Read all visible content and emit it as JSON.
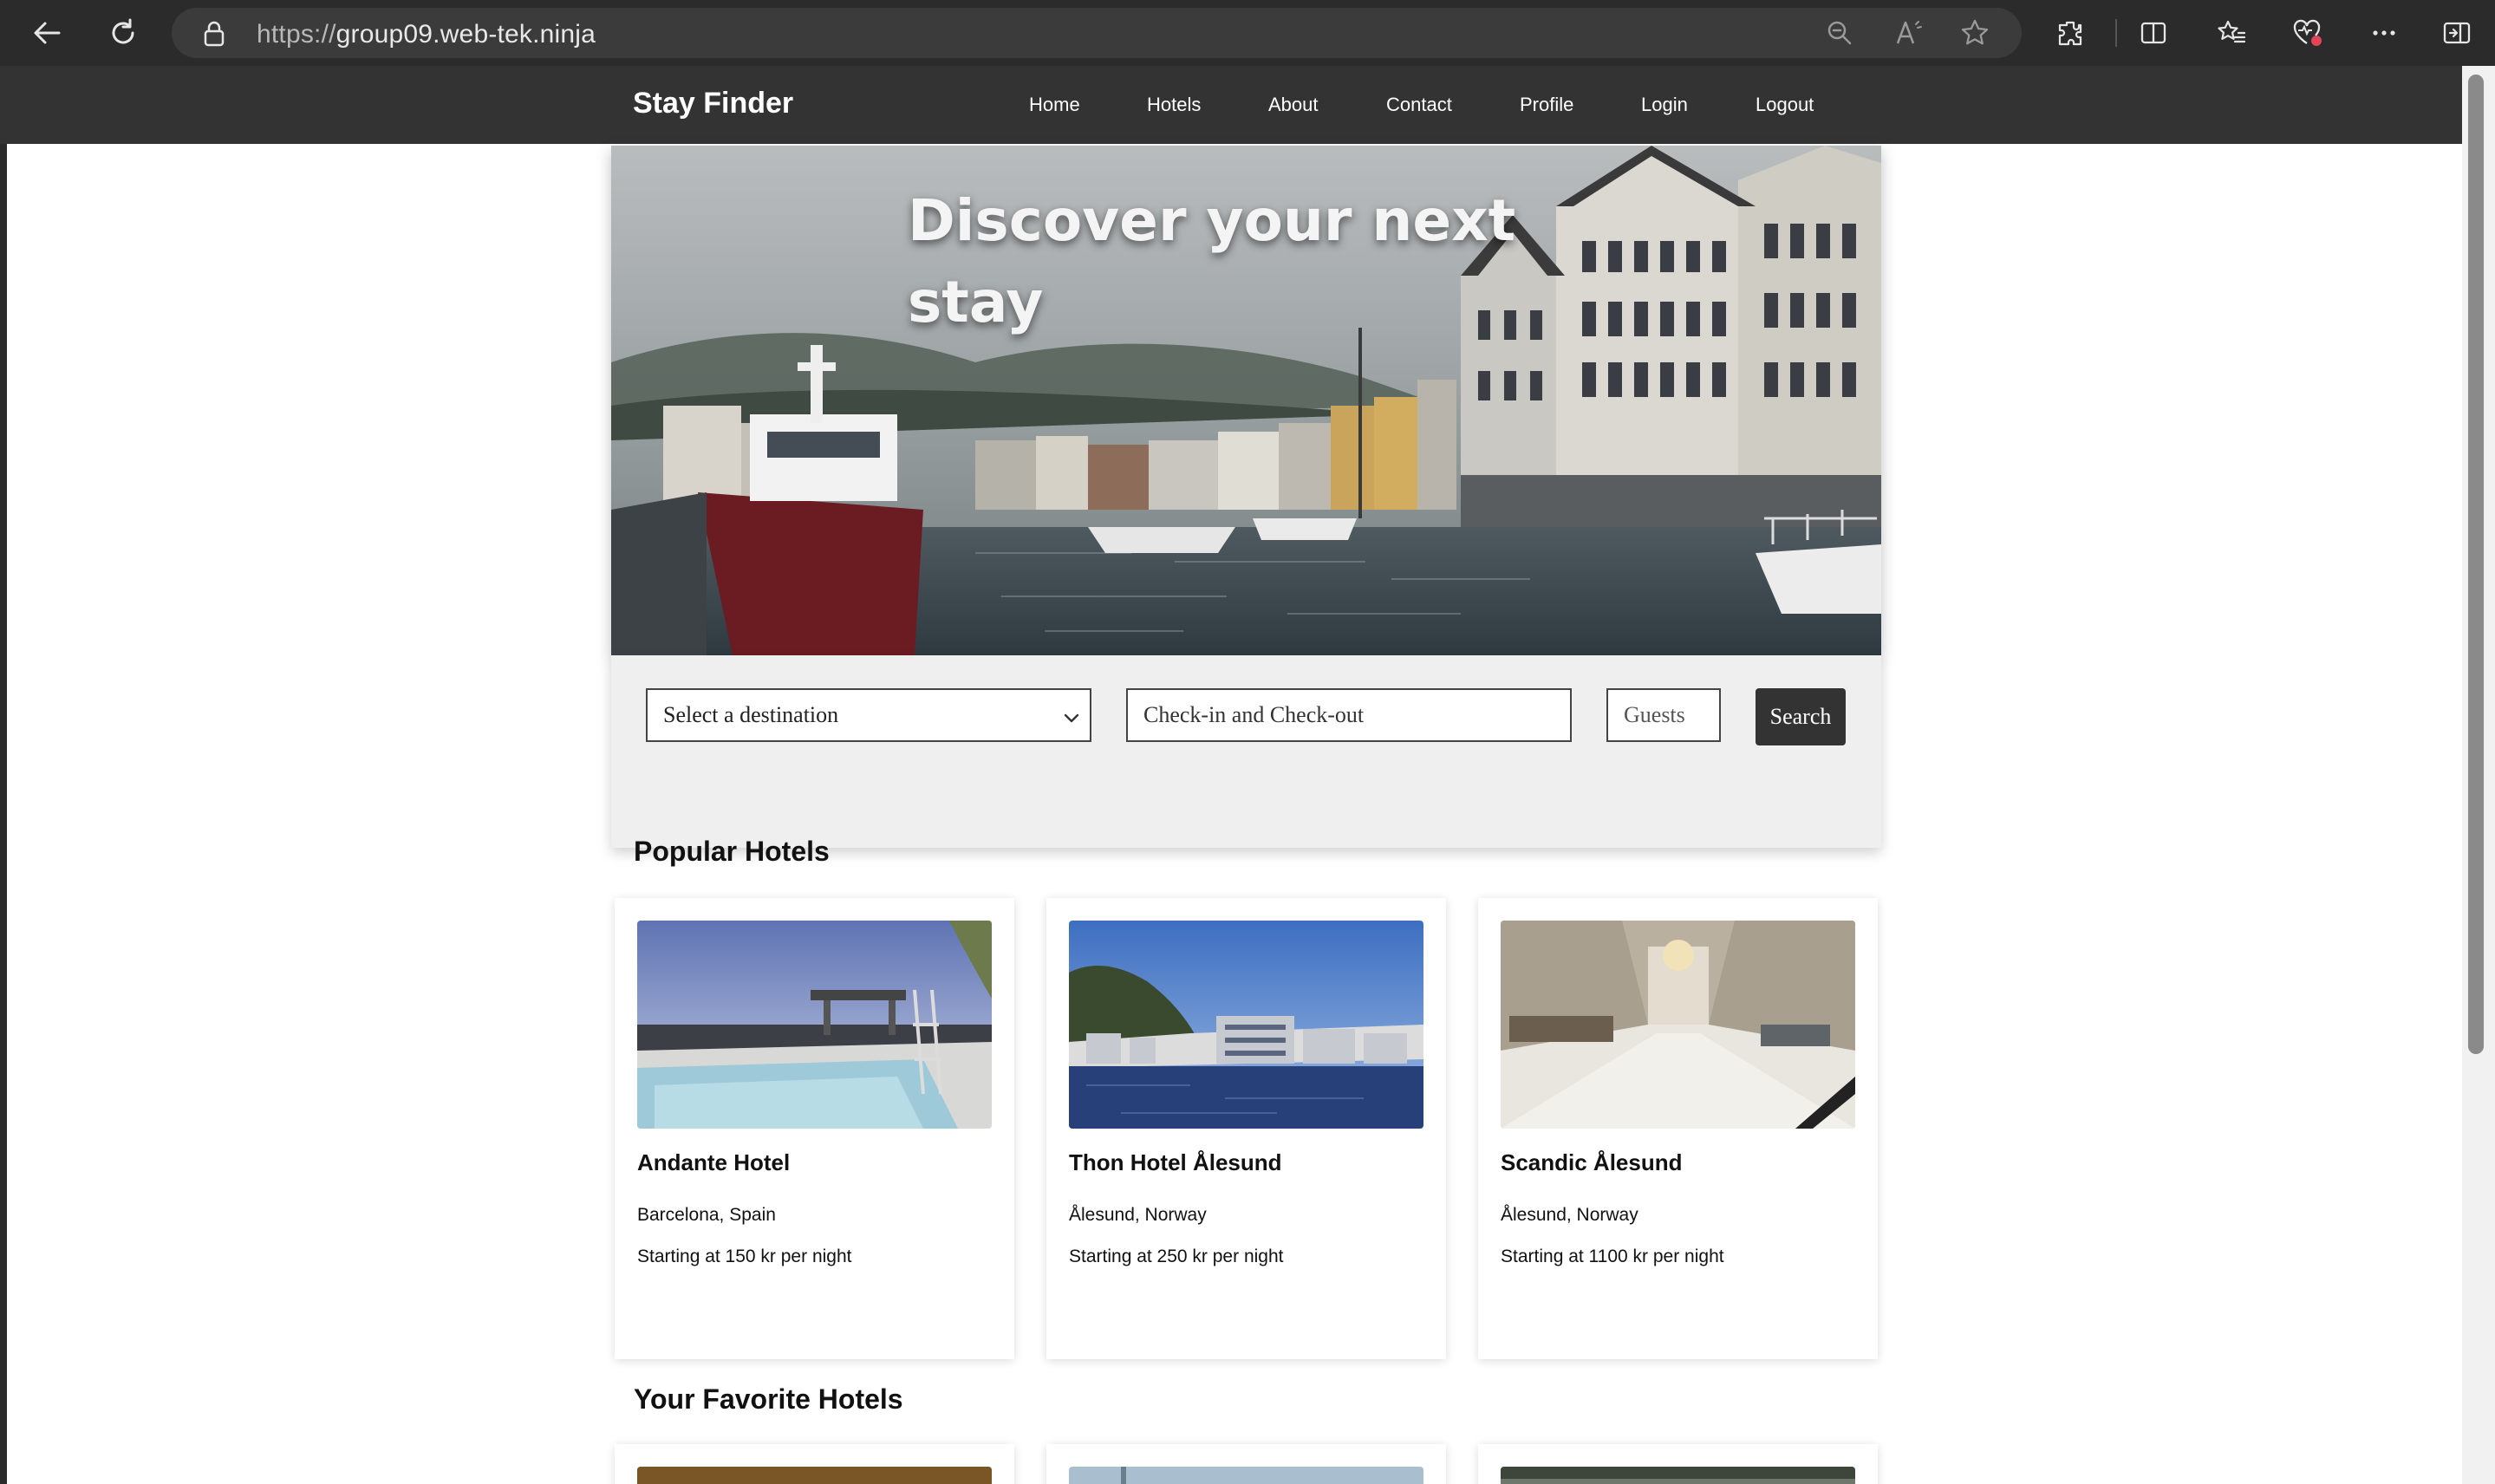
{
  "browser": {
    "url_protocol": "https://",
    "url_host": "group09.web-tek.ninja",
    "icons": [
      "back-icon",
      "refresh-icon",
      "lock-icon",
      "zoom-out-icon",
      "read-aloud-icon",
      "favorite-star-icon",
      "extensions-icon",
      "split-screen-icon",
      "favorites-list-icon",
      "browser-essentials-icon",
      "more-icon",
      "sidebar-icon"
    ]
  },
  "nav": {
    "brand": "Stay Finder",
    "links": [
      "Home",
      "Hotels",
      "About",
      "Contact",
      "Profile",
      "Login",
      "Logout"
    ]
  },
  "hero": {
    "title": "Discover your next stay"
  },
  "search": {
    "destination_value": "Select a destination",
    "dates_placeholder": "Check-in and Check-out",
    "guests_placeholder": "Guests",
    "button_label": "Search"
  },
  "popular": {
    "title": "Popular Hotels",
    "hotels": [
      {
        "name": "Andante Hotel",
        "location": "Barcelona, Spain",
        "price": "Starting at 150 kr per night"
      },
      {
        "name": "Thon Hotel Ålesund",
        "location": "Ålesund, Norway",
        "price": "Starting at 250 kr per night"
      },
      {
        "name": "Scandic Ålesund",
        "location": "Ålesund, Norway",
        "price": "Starting at 1100 kr per night"
      }
    ]
  },
  "favorites": {
    "title": "Your Favorite Hotels"
  },
  "colors": {
    "nav_bg": "#333333",
    "chrome_bg": "#2b2b2b",
    "panel_bg": "#efefef",
    "button_bg": "#333333"
  }
}
